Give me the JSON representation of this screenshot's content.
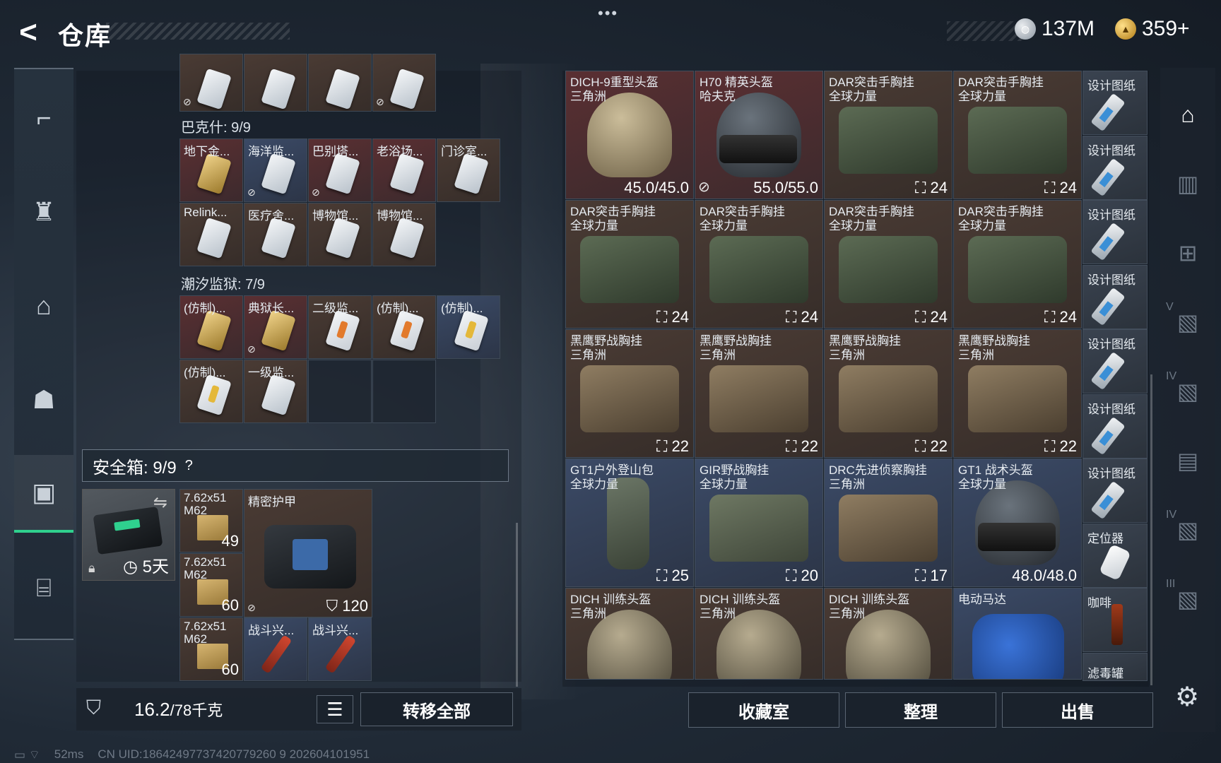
{
  "header": {
    "back_icon": "<",
    "title": "仓库",
    "more": "•••",
    "currencies": [
      {
        "icon": "silver-coin",
        "value": "137M"
      },
      {
        "icon": "gold-coin",
        "value": "359+"
      }
    ]
  },
  "left_nav": [
    {
      "icon": "gun-icon"
    },
    {
      "icon": "armor-icon"
    },
    {
      "icon": "backpack-icon"
    },
    {
      "icon": "bag-icon"
    },
    {
      "icon": "safe-box-icon",
      "active": true
    },
    {
      "icon": "briefcase-icon"
    }
  ],
  "sections": {
    "top_row": [
      {
        "name": "",
        "card": "w",
        "noshare": true
      },
      {
        "name": "",
        "card": "w"
      },
      {
        "name": "",
        "card": "w"
      },
      {
        "name": "",
        "card": "w",
        "noshare": true
      }
    ],
    "bakshi": {
      "title": "巴克什: 9/9",
      "items": [
        {
          "name": "地下金...",
          "card": "g",
          "bg": "red"
        },
        {
          "name": "海洋监...",
          "card": "w",
          "bg": "blue",
          "noshare": true
        },
        {
          "name": "巴别塔...",
          "card": "w",
          "bg": "red",
          "noshare": true
        },
        {
          "name": "老浴场...",
          "card": "w",
          "bg": "red"
        },
        {
          "name": "门诊室...",
          "card": "w",
          "bg": "brown"
        },
        {
          "name": "Relink...",
          "card": "w",
          "bg": "brown"
        },
        {
          "name": "医疗舍...",
          "card": "w",
          "bg": "brown"
        },
        {
          "name": "博物馆...",
          "card": "w",
          "bg": "brown"
        },
        {
          "name": "博物馆...",
          "card": "w",
          "bg": "brown"
        }
      ]
    },
    "tidal": {
      "title": "潮汐监狱: 7/9",
      "items": [
        {
          "name": "(仿制)...",
          "card": "g",
          "bg": "red"
        },
        {
          "name": "典狱长...",
          "card": "g",
          "bg": "red",
          "noshare": true
        },
        {
          "name": "二级监...",
          "card": "o",
          "bg": "brown"
        },
        {
          "name": "(仿制)...",
          "card": "o",
          "bg": "brown"
        },
        {
          "name": "(仿制)...",
          "card": "y",
          "bg": "blue"
        },
        {
          "name": "(仿制)...",
          "card": "y",
          "bg": "brown"
        },
        {
          "name": "一级监...",
          "card": "w",
          "bg": "brown"
        }
      ]
    }
  },
  "safe": {
    "label": "安全箱:  9/9",
    "help": "?",
    "days": "5天",
    "items": {
      "ammo": [
        {
          "name": "7.62x51 M62",
          "qty": "49"
        },
        {
          "name": "7.62x51 M62",
          "qty": "60"
        },
        {
          "name": "7.62x51 M62",
          "qty": "60"
        }
      ],
      "vest": {
        "name": "精密护甲",
        "qty": "120"
      },
      "sticks": [
        {
          "name": "战斗兴..."
        },
        {
          "name": "战斗兴..."
        }
      ]
    }
  },
  "weight": {
    "value": "16.2",
    "max": "/78千克"
  },
  "transfer_label": "转移全部",
  "right_items": [
    {
      "name": "DICH-9重型头盔",
      "sub": "三角洲",
      "qty": "45.0/45.0",
      "img": "helmet camo",
      "bg": "red"
    },
    {
      "name": "H70 精英头盔",
      "sub": "哈夫克",
      "qty": "55.0/55.0",
      "img": "helmet dark",
      "bg": "red",
      "noshare": true
    },
    {
      "name": "DAR突击手胸挂",
      "sub": "全球力量",
      "qty": "24",
      "img": "bp green",
      "bg": "brown",
      "cap": true
    },
    {
      "name": "DAR突击手胸挂",
      "sub": "全球力量",
      "qty": "24",
      "img": "bp green",
      "bg": "brown",
      "cap": true
    },
    {
      "name": "DAR突击手胸挂",
      "sub": "全球力量",
      "qty": "24",
      "img": "bp green",
      "bg": "brown",
      "cap": true
    },
    {
      "name": "DAR突击手胸挂",
      "sub": "全球力量",
      "qty": "24",
      "img": "bp green",
      "bg": "brown",
      "cap": true
    },
    {
      "name": "DAR突击手胸挂",
      "sub": "全球力量",
      "qty": "24",
      "img": "bp green",
      "bg": "brown",
      "cap": true
    },
    {
      "name": "DAR突击手胸挂",
      "sub": "全球力量",
      "qty": "24",
      "img": "bp green",
      "bg": "brown",
      "cap": true
    },
    {
      "name": "黑鹰野战胸挂",
      "sub": "三角洲",
      "qty": "22",
      "img": "bp tan",
      "bg": "brown",
      "cap": true
    },
    {
      "name": "黑鹰野战胸挂",
      "sub": "三角洲",
      "qty": "22",
      "img": "bp tan",
      "bg": "brown",
      "cap": true
    },
    {
      "name": "黑鹰野战胸挂",
      "sub": "三角洲",
      "qty": "22",
      "img": "bp tan",
      "bg": "brown",
      "cap": true
    },
    {
      "name": "黑鹰野战胸挂",
      "sub": "三角洲",
      "qty": "22",
      "img": "bp tan",
      "bg": "brown",
      "cap": true
    },
    {
      "name": "GT1户外登山包",
      "sub": "全球力量",
      "qty": "25",
      "img": "tall",
      "bg": "blue",
      "cap": true
    },
    {
      "name": "GIR野战胸挂",
      "sub": "全球力量",
      "qty": "20",
      "img": "bp olive",
      "bg": "blue",
      "cap": true
    },
    {
      "name": "DRC先进侦察胸挂",
      "sub": "三角洲",
      "qty": "17",
      "img": "bp tan",
      "bg": "blue",
      "cap": true
    },
    {
      "name": "GT1 战术头盔",
      "sub": "全球力量",
      "qty": "48.0/48.0",
      "img": "helmet dark",
      "bg": "blue"
    },
    {
      "name": "DICH 训练头盔",
      "sub": "三角洲",
      "qty": "",
      "img": "helmet sand",
      "bg": "brown"
    },
    {
      "name": "DICH 训练头盔",
      "sub": "三角洲",
      "qty": "",
      "img": "helmet sand",
      "bg": "brown"
    },
    {
      "name": "DICH 训练头盔",
      "sub": "三角洲",
      "qty": "",
      "img": "helmet sand",
      "bg": "brown"
    },
    {
      "name": "电动马达",
      "sub": "",
      "qty": "",
      "img": "motor",
      "bg": "blue"
    }
  ],
  "right_small": [
    {
      "name": "设计图纸",
      "img": "print"
    },
    {
      "name": "设计图纸",
      "img": "print"
    },
    {
      "name": "设计图纸",
      "img": "print"
    },
    {
      "name": "设计图纸",
      "img": "print"
    },
    {
      "name": "设计图纸",
      "img": "print"
    },
    {
      "name": "设计图纸",
      "img": "print"
    },
    {
      "name": "设计图纸",
      "img": "print"
    },
    {
      "name": "定位器",
      "img": "loc"
    },
    {
      "name": "咖啡",
      "img": "bottle"
    },
    {
      "name": "滤毒罐",
      "img": ""
    }
  ],
  "right_buttons": [
    "收藏室",
    "整理",
    "出售"
  ],
  "right_nav": [
    {
      "icon": "warehouse-icon",
      "active": true
    },
    {
      "icon": "rack-icon"
    },
    {
      "icon": "add-rack-icon"
    },
    {
      "icon": "level-v-icon",
      "label": "V"
    },
    {
      "icon": "level-iv-icon",
      "label": "IV"
    },
    {
      "icon": "shelf-icon"
    },
    {
      "icon": "level-iv-2-icon",
      "label": "IV"
    },
    {
      "icon": "level-iii-icon",
      "label": "III"
    }
  ],
  "footer": {
    "ping": "52ms",
    "uid": "CN UID:18642497737420779260 9 202604101951"
  },
  "colors": {
    "accent": "#2fd08e",
    "panel": "#1a222c"
  }
}
